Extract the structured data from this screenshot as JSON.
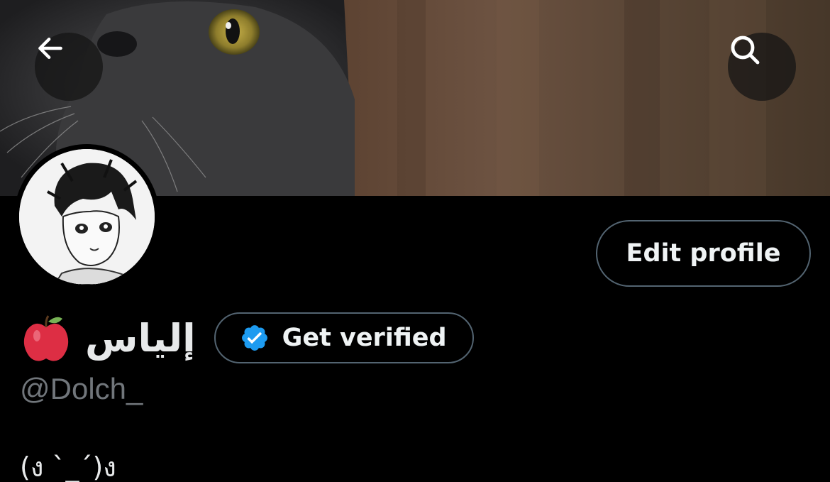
{
  "header": {
    "back_icon": "arrow-left-icon",
    "search_icon": "search-icon"
  },
  "profile": {
    "display_name": "إلياس",
    "name_emoji": "red-apple-icon",
    "handle": "@Dolch_",
    "bio": "(ง ˋ̀_ˊ́)ง"
  },
  "actions": {
    "edit_profile_label": "Edit profile",
    "get_verified_label": "Get verified"
  },
  "colors": {
    "background": "#000000",
    "verified_blue": "#1d9bf0",
    "border": "#536471",
    "secondary_text": "#71767b"
  }
}
